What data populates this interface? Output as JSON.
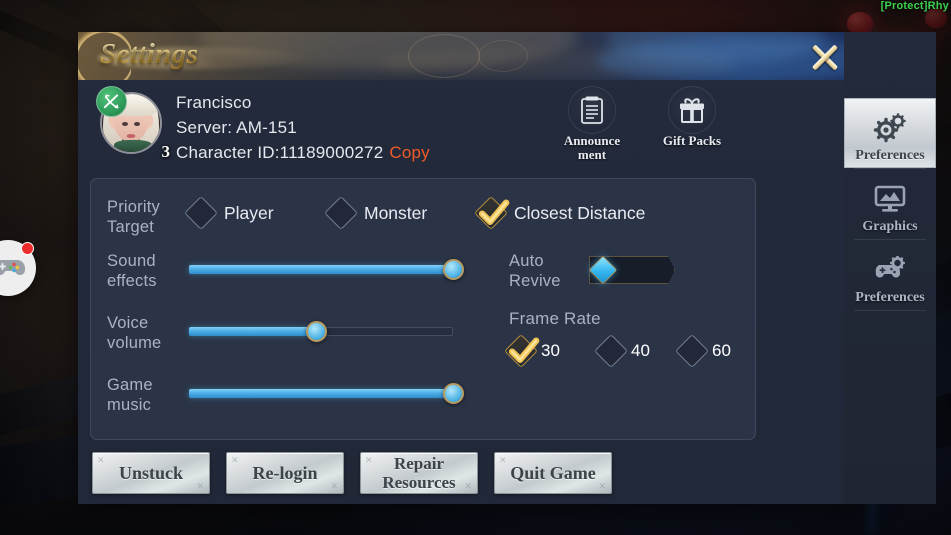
{
  "background": {
    "top_notice": "[Protect]Rhy",
    "floating_button_icon": "gamepad-icon"
  },
  "dialog": {
    "title": "Settings",
    "close_icon": "close-icon"
  },
  "account": {
    "name": "Francisco",
    "server": "Server: AM-151",
    "character_id": "Character ID:11189000272",
    "copy_label": "Copy",
    "level": "3",
    "class_badge_icon": "crossed-bow-icon",
    "avatar_icon": "avatar"
  },
  "header_icons": [
    {
      "label": "Announce\nment",
      "label_line1": "Announce",
      "label_line2": "ment",
      "icon": "announcement-icon"
    },
    {
      "label": "Gift Packs",
      "label_line1": "Gift Packs",
      "label_line2": "",
      "icon": "gift-icon"
    }
  ],
  "settings": {
    "priority_target": {
      "label_line1": "Priority",
      "label_line2": "Target",
      "options": [
        {
          "label": "Player",
          "selected": false
        },
        {
          "label": "Monster",
          "selected": false
        },
        {
          "label": "Closest Distance",
          "selected": true
        }
      ]
    },
    "sound_effects": {
      "label_line1": "Sound",
      "label_line2": "effects",
      "value": 100
    },
    "voice_volume": {
      "label_line1": "Voice",
      "label_line2": "volume",
      "value": 48
    },
    "game_music": {
      "label_line1": "Game",
      "label_line2": "music",
      "value": 100
    },
    "auto_revive": {
      "label_line1": "Auto",
      "label_line2": "Revive",
      "enabled": false
    },
    "frame_rate": {
      "label": "Frame Rate",
      "options": [
        {
          "label": "30",
          "selected": true
        },
        {
          "label": "40",
          "selected": false
        },
        {
          "label": "60",
          "selected": false
        }
      ]
    }
  },
  "bottom_buttons": [
    {
      "line1": "Unstuck",
      "line2": ""
    },
    {
      "line1": "Re-login",
      "line2": ""
    },
    {
      "line1": "Repair",
      "line2": "Resources"
    },
    {
      "line1": "Quit Game",
      "line2": ""
    }
  ],
  "sidebar": {
    "tabs": [
      {
        "label": "Preferences",
        "icon": "gears-icon",
        "active": true
      },
      {
        "label": "Graphics",
        "icon": "monitor-icon",
        "active": false
      },
      {
        "label": "Preferences",
        "icon": "gamepad-gear-icon",
        "active": false
      }
    ]
  },
  "colors": {
    "accent_gold": "#e8c87e",
    "copy_orange": "#f05a28",
    "slider_blue": "#46a8e3",
    "panel_bg": "#2b3446",
    "dialog_bg": "#222a3b"
  }
}
